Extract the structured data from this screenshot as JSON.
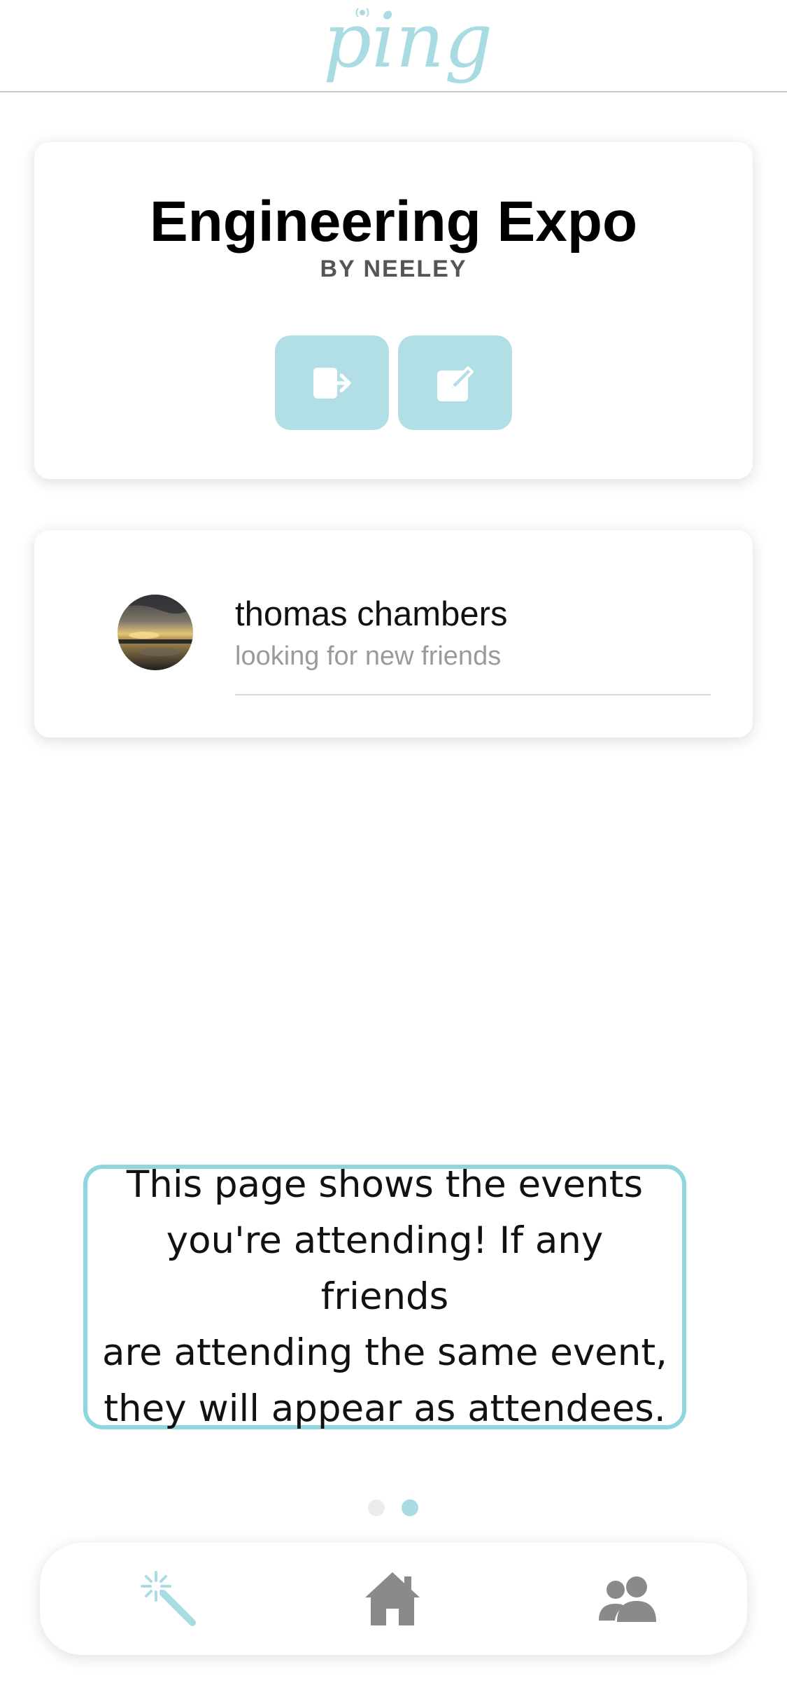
{
  "app": {
    "logo_text": "ping",
    "brand_color": "#a9dbe3",
    "accent_button_color": "#b2dfe5"
  },
  "event": {
    "title": "Engineering Expo",
    "by": "BY NEELEY",
    "actions": [
      {
        "icon": "leave-event-icon"
      },
      {
        "icon": "edit-icon"
      }
    ]
  },
  "attendees": [
    {
      "name": "thomas chambers",
      "status": "looking for new friends",
      "avatar": "sunset-landscape-photo"
    }
  ],
  "tooltip": {
    "text": "This page shows the events\nyou're attending! If any friends\nare attending the same  event,\nthey will appear as attendees."
  },
  "pagination": {
    "total": 2,
    "active": 2
  },
  "nav": {
    "items": [
      {
        "icon": "magic-wand-icon",
        "active": true
      },
      {
        "icon": "home-icon",
        "active": false
      },
      {
        "icon": "friends-icon",
        "active": false
      }
    ]
  }
}
